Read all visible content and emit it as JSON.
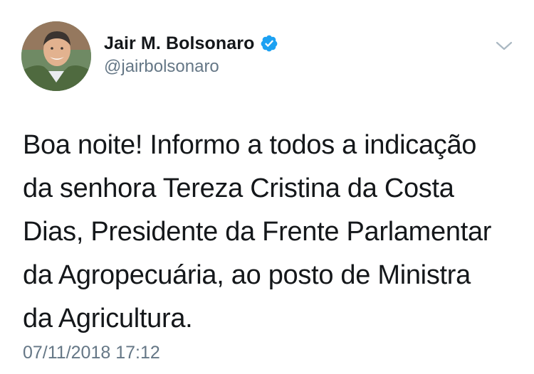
{
  "tweet": {
    "display_name": "Jair M. Bolsonaro",
    "handle": "@jairbolsonaro",
    "verified_icon": "verified-badge-icon",
    "caret_icon": "chevron-down-icon",
    "text_lines": [
      "Boa noite! Informo a todos a indicação",
      "da senhora Tereza Cristina da Costa",
      "Dias, Presidente da Frente Parlamentar",
      "da Agropecuária, ao posto de Ministra",
      "da Agricultura."
    ],
    "timestamp": "07/11/2018 17:12"
  },
  "colors": {
    "verified_blue": "#1da1f2",
    "secondary_text": "#657786",
    "primary_text": "#14171a"
  }
}
